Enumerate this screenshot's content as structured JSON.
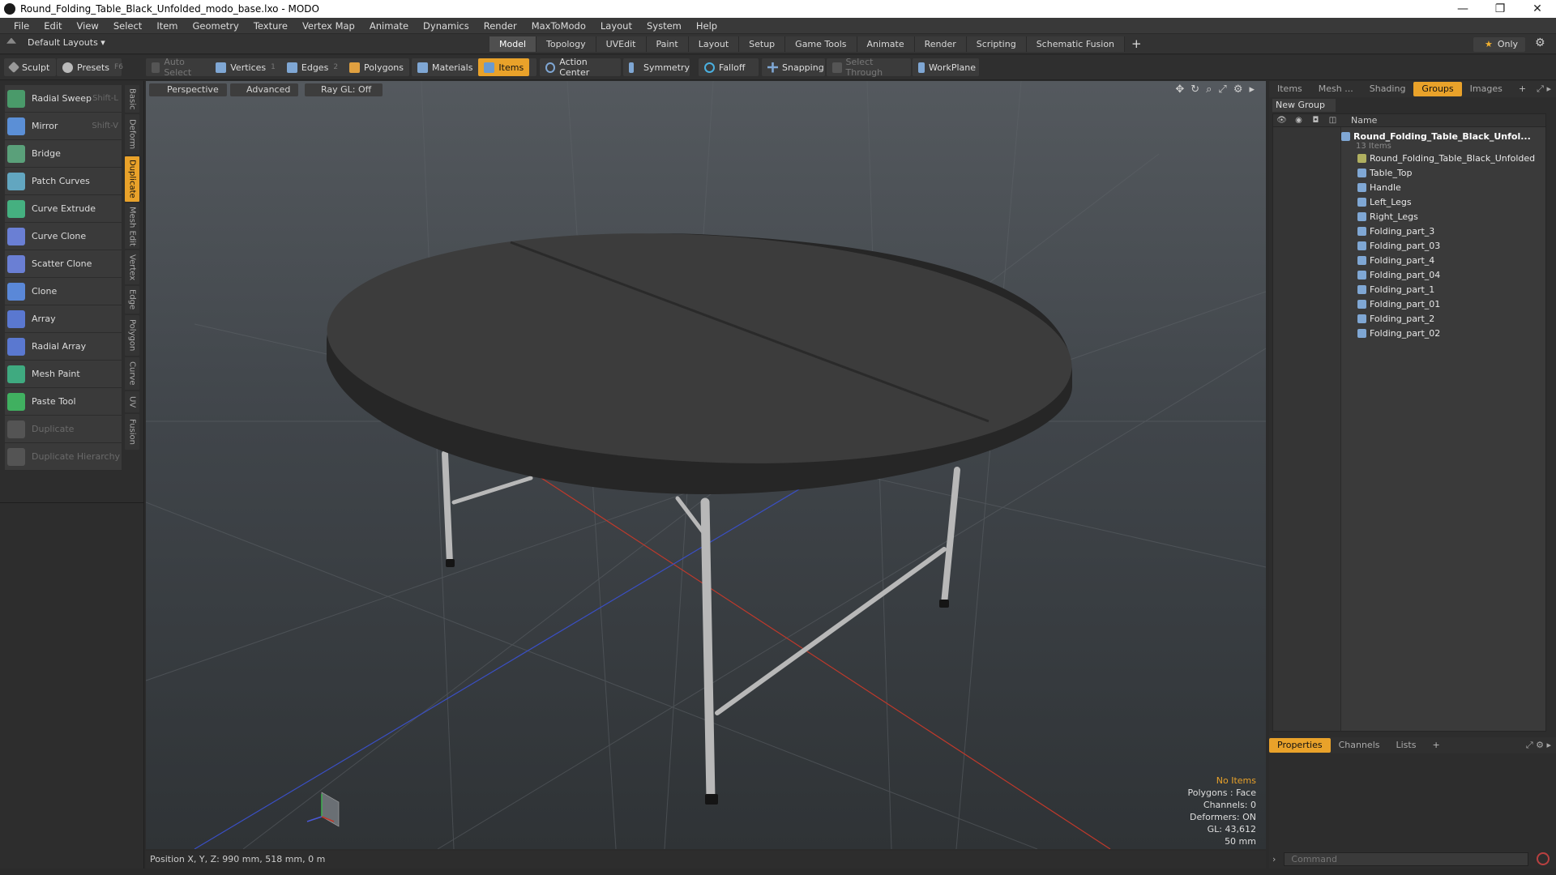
{
  "window": {
    "title": "Round_Folding_Table_Black_Unfolded_modo_base.lxo - MODO",
    "controls": [
      "—",
      "❐",
      "✕"
    ]
  },
  "menu": [
    "File",
    "Edit",
    "View",
    "Select",
    "Item",
    "Geometry",
    "Texture",
    "Vertex Map",
    "Animate",
    "Dynamics",
    "Render",
    "MaxToModo",
    "Layout",
    "System",
    "Help"
  ],
  "layout": {
    "selector": "Default Layouts ▾",
    "tabs": [
      "Model",
      "Topology",
      "UVEdit",
      "Paint",
      "Layout",
      "Setup",
      "Game Tools",
      "Animate",
      "Render",
      "Scripting",
      "Schematic Fusion"
    ],
    "active_tab": "Model",
    "add": "+",
    "only": "Only"
  },
  "toolbar": {
    "sculpt": "Sculpt",
    "presets": "Presets",
    "presets_key": "F6",
    "auto_select": "Auto Select",
    "vertices": "Vertices",
    "vertices_count": "1",
    "edges": "Edges",
    "edges_count": "2",
    "polygons": "Polygons",
    "materials": "Materials",
    "items": "Items",
    "action_center": "Action Center",
    "symmetry": "Symmetry",
    "falloff": "Falloff",
    "snapping": "Snapping",
    "select_through": "Select Through",
    "workplane": "WorkPlane"
  },
  "tools": [
    {
      "label": "Radial Sweep",
      "key": "Shift-L",
      "color": "#4a9a6a",
      "enabled": true
    },
    {
      "label": "Mirror",
      "key": "Shift-V",
      "color": "#5b8fd6",
      "enabled": true
    },
    {
      "label": "Bridge",
      "key": "",
      "color": "#5aa07a",
      "enabled": true
    },
    {
      "label": "Patch Curves",
      "key": "",
      "color": "#62a6c0",
      "enabled": true
    },
    {
      "label": "Curve Extrude",
      "key": "",
      "color": "#45b080",
      "enabled": true
    },
    {
      "label": "Curve Clone",
      "key": "",
      "color": "#6a7fd4",
      "enabled": true
    },
    {
      "label": "Scatter Clone",
      "key": "",
      "color": "#6a7fd4",
      "enabled": true
    },
    {
      "label": "Clone",
      "key": "",
      "color": "#5a88d8",
      "enabled": true
    },
    {
      "label": "Array",
      "key": "",
      "color": "#5a78d0",
      "enabled": true
    },
    {
      "label": "Radial Array",
      "key": "",
      "color": "#5a78d0",
      "enabled": true
    },
    {
      "label": "Mesh Paint",
      "key": "",
      "color": "#3faa80",
      "enabled": true
    },
    {
      "label": "Paste Tool",
      "key": "",
      "color": "#40b060",
      "enabled": true
    },
    {
      "label": "Duplicate",
      "key": "",
      "color": "#888888",
      "enabled": false
    },
    {
      "label": "Duplicate Hierarchy",
      "key": "",
      "color": "#888888",
      "enabled": false
    }
  ],
  "side_tabs": [
    {
      "label": "Basic",
      "h": 34,
      "active": false
    },
    {
      "label": "Deform",
      "h": 50,
      "active": false
    },
    {
      "label": "Duplicate",
      "h": 56,
      "active": true
    },
    {
      "label": "Mesh Edit",
      "h": 56,
      "active": false
    },
    {
      "label": "Vertex",
      "h": 42,
      "active": false
    },
    {
      "label": "Edge",
      "h": 34,
      "active": false
    },
    {
      "label": "Polygon",
      "h": 50,
      "active": false
    },
    {
      "label": "Curve",
      "h": 40,
      "active": false
    },
    {
      "label": "UV",
      "h": 26,
      "active": false
    },
    {
      "label": "Fusion",
      "h": 44,
      "active": false
    }
  ],
  "viewport": {
    "perspective": "Perspective",
    "advanced": "Advanced",
    "raygl": "Ray GL: Off",
    "info": {
      "no_items": "No Items",
      "polygons": "Polygons : Face",
      "channels": "Channels: 0",
      "deformers": "Deformers: ON",
      "gl": "GL: 43,612",
      "size": "50 mm"
    }
  },
  "status": {
    "position": "Position X, Y, Z:  990 mm, 518 mm, 0 m"
  },
  "right_panel": {
    "top_tabs": [
      "Items",
      "Mesh ...",
      "Shading",
      "Groups",
      "Images"
    ],
    "active_top_tab": "Groups",
    "new_group": "New Group",
    "name_header": "Name",
    "root": "Round_Folding_Table_Black_Unfol...",
    "root_sub": "13 Items",
    "items": [
      "Round_Folding_Table_Black_Unfolded",
      "Table_Top",
      "Handle",
      "Left_Legs",
      "Right_Legs",
      "Folding_part_3",
      "Folding_part_03",
      "Folding_part_4",
      "Folding_part_04",
      "Folding_part_1",
      "Folding_part_01",
      "Folding_part_2",
      "Folding_part_02"
    ],
    "bottom_tabs": [
      "Properties",
      "Channels",
      "Lists"
    ],
    "active_bottom_tab": "Properties",
    "command_placeholder": "Command"
  },
  "colors": {
    "accent": "#e9a22a",
    "axis_x": "#c0392b",
    "axis_z": "#3a4fc4",
    "table_top": "#3c3c3c",
    "legs": "#b8b8b8"
  }
}
